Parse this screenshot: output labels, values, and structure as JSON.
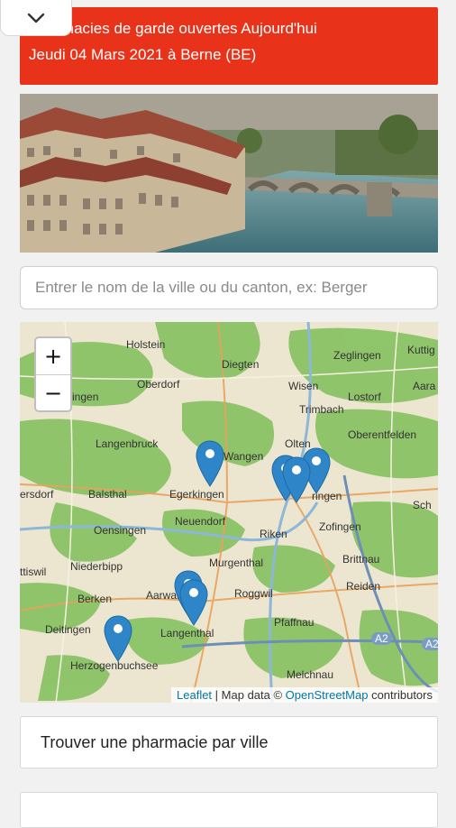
{
  "header": {
    "line1": "Pharmacies de garde ouvertes Aujourd'hui",
    "line2": "Jeudi 04 Mars 2021 à Berne (BE)"
  },
  "colors": {
    "header_bg": "#e8321a",
    "pin": "#2e86c9",
    "link": "#0078a8"
  },
  "search": {
    "placeholder": "Entrer le nom de la ville ou du canton, ex: Berger"
  },
  "map": {
    "zoom_in": "+",
    "zoom_out": "−",
    "attribution": {
      "leaflet": "Leaflet",
      "sep": " | Map data © ",
      "osm": "OpenStreetMap",
      "tail": " contributors"
    },
    "places": [
      "Holstein",
      "Diegten",
      "Zeglingen",
      "Kuttig",
      "Oberdorf",
      "Wisen",
      "Lostorf",
      "Aara",
      "ingen",
      "Trimbach",
      "Oberentfelden",
      "Langenbruck",
      "Wangen",
      "Olten",
      "ersdorf",
      "Balsthal",
      "Egerkingen",
      "ringen",
      "Sch",
      "Oensingen",
      "Neuendorf",
      "Riken",
      "Zofingen",
      "Niederbipp",
      "Murgenthal",
      "Brittnau",
      "ttiswil",
      "Berken",
      "Aarwangen",
      "Roggwil",
      "Reiden",
      "Deitingen",
      "Langenthal",
      "Pfaffnau",
      "Herzogenbuchsee",
      "Melchnau",
      "A2",
      "A2"
    ]
  },
  "find_button": "Trouver une pharmacie par ville"
}
